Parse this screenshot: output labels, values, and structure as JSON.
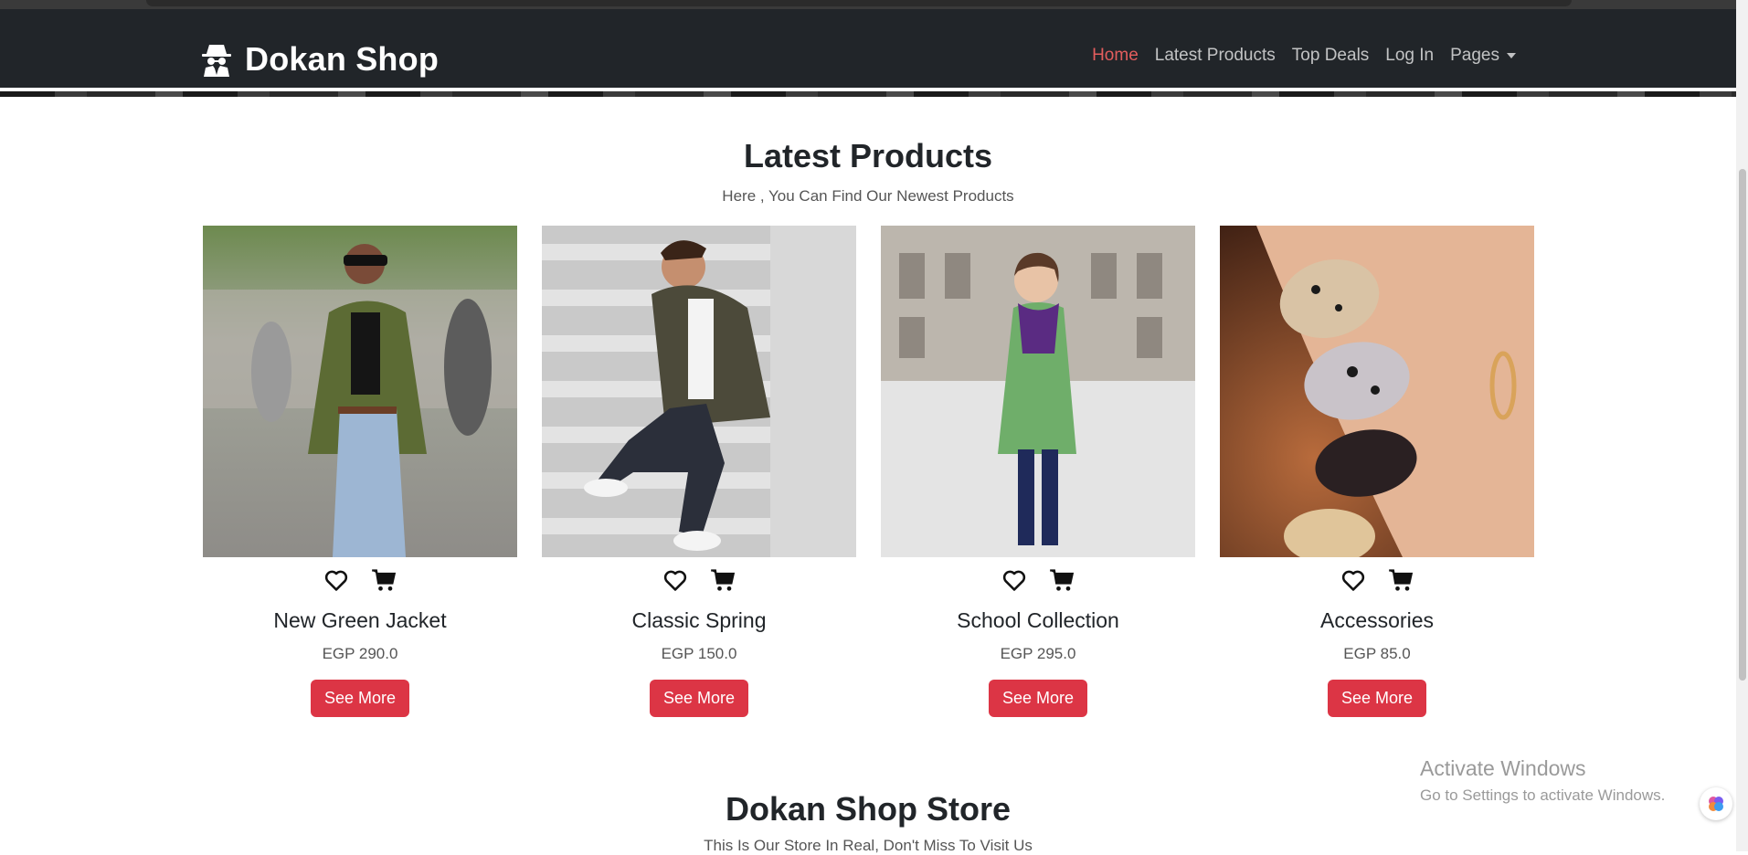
{
  "brand": {
    "name": "Dokan Shop",
    "icon": "spy-icon"
  },
  "nav": {
    "items": [
      {
        "label": "Home",
        "active": true
      },
      {
        "label": "Latest Products",
        "active": false
      },
      {
        "label": "Top Deals",
        "active": false
      },
      {
        "label": "Log In",
        "active": false
      },
      {
        "label": "Pages",
        "active": false,
        "dropdown": true
      }
    ]
  },
  "latest": {
    "title": "Latest Products",
    "subtitle": "Here , You Can Find Our Newest Products",
    "products": [
      {
        "name": "New Green Jacket",
        "price": "EGP 290.0",
        "button": "See More"
      },
      {
        "name": "Classic Spring",
        "price": "EGP 150.0",
        "button": "See More"
      },
      {
        "name": "School Collection",
        "price": "EGP 295.0",
        "button": "See More"
      },
      {
        "name": "Accessories",
        "price": "EGP 85.0",
        "button": "See More"
      }
    ]
  },
  "store": {
    "title": "Dokan Shop Store",
    "subtitle": "This Is Our Store In Real, Don't Miss To Visit Us"
  },
  "watermark": {
    "title": "Activate Windows",
    "subtitle": "Go to Settings to activate Windows."
  },
  "colors": {
    "navbar": "#212529",
    "accent": "#dc3545",
    "active_link": "#e35d5d"
  }
}
